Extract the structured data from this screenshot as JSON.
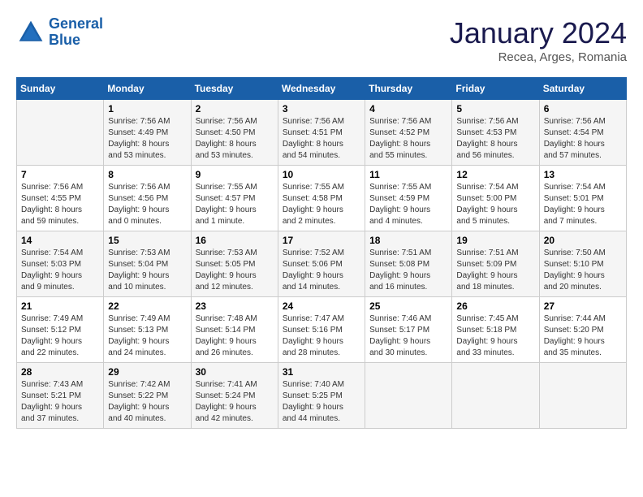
{
  "header": {
    "logo_general": "General",
    "logo_blue": "Blue",
    "month_title": "January 2024",
    "location": "Recea, Arges, Romania"
  },
  "days_of_week": [
    "Sunday",
    "Monday",
    "Tuesday",
    "Wednesday",
    "Thursday",
    "Friday",
    "Saturday"
  ],
  "weeks": [
    [
      {
        "day": "",
        "info": ""
      },
      {
        "day": "1",
        "info": "Sunrise: 7:56 AM\nSunset: 4:49 PM\nDaylight: 8 hours\nand 53 minutes."
      },
      {
        "day": "2",
        "info": "Sunrise: 7:56 AM\nSunset: 4:50 PM\nDaylight: 8 hours\nand 53 minutes."
      },
      {
        "day": "3",
        "info": "Sunrise: 7:56 AM\nSunset: 4:51 PM\nDaylight: 8 hours\nand 54 minutes."
      },
      {
        "day": "4",
        "info": "Sunrise: 7:56 AM\nSunset: 4:52 PM\nDaylight: 8 hours\nand 55 minutes."
      },
      {
        "day": "5",
        "info": "Sunrise: 7:56 AM\nSunset: 4:53 PM\nDaylight: 8 hours\nand 56 minutes."
      },
      {
        "day": "6",
        "info": "Sunrise: 7:56 AM\nSunset: 4:54 PM\nDaylight: 8 hours\nand 57 minutes."
      }
    ],
    [
      {
        "day": "7",
        "info": "Sunrise: 7:56 AM\nSunset: 4:55 PM\nDaylight: 8 hours\nand 59 minutes."
      },
      {
        "day": "8",
        "info": "Sunrise: 7:56 AM\nSunset: 4:56 PM\nDaylight: 9 hours\nand 0 minutes."
      },
      {
        "day": "9",
        "info": "Sunrise: 7:55 AM\nSunset: 4:57 PM\nDaylight: 9 hours\nand 1 minute."
      },
      {
        "day": "10",
        "info": "Sunrise: 7:55 AM\nSunset: 4:58 PM\nDaylight: 9 hours\nand 2 minutes."
      },
      {
        "day": "11",
        "info": "Sunrise: 7:55 AM\nSunset: 4:59 PM\nDaylight: 9 hours\nand 4 minutes."
      },
      {
        "day": "12",
        "info": "Sunrise: 7:54 AM\nSunset: 5:00 PM\nDaylight: 9 hours\nand 5 minutes."
      },
      {
        "day": "13",
        "info": "Sunrise: 7:54 AM\nSunset: 5:01 PM\nDaylight: 9 hours\nand 7 minutes."
      }
    ],
    [
      {
        "day": "14",
        "info": "Sunrise: 7:54 AM\nSunset: 5:03 PM\nDaylight: 9 hours\nand 9 minutes."
      },
      {
        "day": "15",
        "info": "Sunrise: 7:53 AM\nSunset: 5:04 PM\nDaylight: 9 hours\nand 10 minutes."
      },
      {
        "day": "16",
        "info": "Sunrise: 7:53 AM\nSunset: 5:05 PM\nDaylight: 9 hours\nand 12 minutes."
      },
      {
        "day": "17",
        "info": "Sunrise: 7:52 AM\nSunset: 5:06 PM\nDaylight: 9 hours\nand 14 minutes."
      },
      {
        "day": "18",
        "info": "Sunrise: 7:51 AM\nSunset: 5:08 PM\nDaylight: 9 hours\nand 16 minutes."
      },
      {
        "day": "19",
        "info": "Sunrise: 7:51 AM\nSunset: 5:09 PM\nDaylight: 9 hours\nand 18 minutes."
      },
      {
        "day": "20",
        "info": "Sunrise: 7:50 AM\nSunset: 5:10 PM\nDaylight: 9 hours\nand 20 minutes."
      }
    ],
    [
      {
        "day": "21",
        "info": "Sunrise: 7:49 AM\nSunset: 5:12 PM\nDaylight: 9 hours\nand 22 minutes."
      },
      {
        "day": "22",
        "info": "Sunrise: 7:49 AM\nSunset: 5:13 PM\nDaylight: 9 hours\nand 24 minutes."
      },
      {
        "day": "23",
        "info": "Sunrise: 7:48 AM\nSunset: 5:14 PM\nDaylight: 9 hours\nand 26 minutes."
      },
      {
        "day": "24",
        "info": "Sunrise: 7:47 AM\nSunset: 5:16 PM\nDaylight: 9 hours\nand 28 minutes."
      },
      {
        "day": "25",
        "info": "Sunrise: 7:46 AM\nSunset: 5:17 PM\nDaylight: 9 hours\nand 30 minutes."
      },
      {
        "day": "26",
        "info": "Sunrise: 7:45 AM\nSunset: 5:18 PM\nDaylight: 9 hours\nand 33 minutes."
      },
      {
        "day": "27",
        "info": "Sunrise: 7:44 AM\nSunset: 5:20 PM\nDaylight: 9 hours\nand 35 minutes."
      }
    ],
    [
      {
        "day": "28",
        "info": "Sunrise: 7:43 AM\nSunset: 5:21 PM\nDaylight: 9 hours\nand 37 minutes."
      },
      {
        "day": "29",
        "info": "Sunrise: 7:42 AM\nSunset: 5:22 PM\nDaylight: 9 hours\nand 40 minutes."
      },
      {
        "day": "30",
        "info": "Sunrise: 7:41 AM\nSunset: 5:24 PM\nDaylight: 9 hours\nand 42 minutes."
      },
      {
        "day": "31",
        "info": "Sunrise: 7:40 AM\nSunset: 5:25 PM\nDaylight: 9 hours\nand 44 minutes."
      },
      {
        "day": "",
        "info": ""
      },
      {
        "day": "",
        "info": ""
      },
      {
        "day": "",
        "info": ""
      }
    ]
  ]
}
